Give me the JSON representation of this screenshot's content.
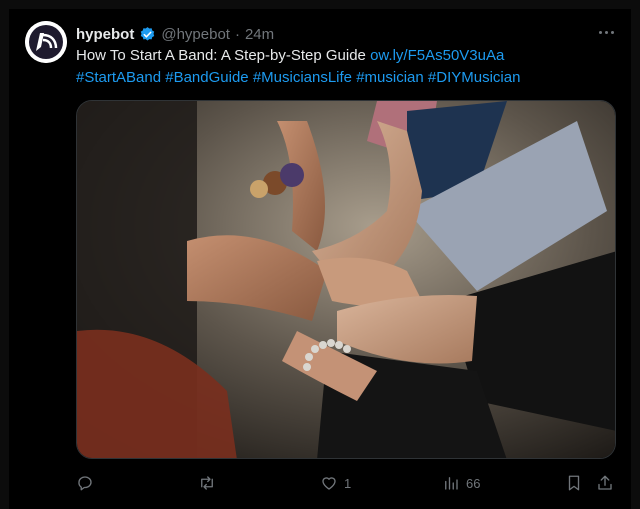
{
  "tweet": {
    "display_name": "hypebot",
    "handle": "@hypebot",
    "separator": "·",
    "time": "24m",
    "text_main": "How To Start A Band: A Step-by-Step Guide ",
    "link": "ow.ly/F5As50V3uAa",
    "hashtags": [
      "#StartABand",
      "#BandGuide",
      "#MusiciansLife",
      "#musician",
      "#DIYMusician"
    ]
  },
  "actions": {
    "reply_count": "",
    "retweet_count": "",
    "like_count": "1",
    "views_count": "66"
  },
  "icons": {
    "verified": "verified-badge-icon",
    "more": "more-options-icon",
    "reply": "reply-icon",
    "retweet": "retweet-icon",
    "like": "heart-icon",
    "views": "views-chart-icon",
    "bookmark": "bookmark-icon",
    "share": "share-icon"
  },
  "colors": {
    "background": "#000000",
    "text": "#e7e9ea",
    "muted": "#71767b",
    "accent": "#1d9bf0"
  }
}
